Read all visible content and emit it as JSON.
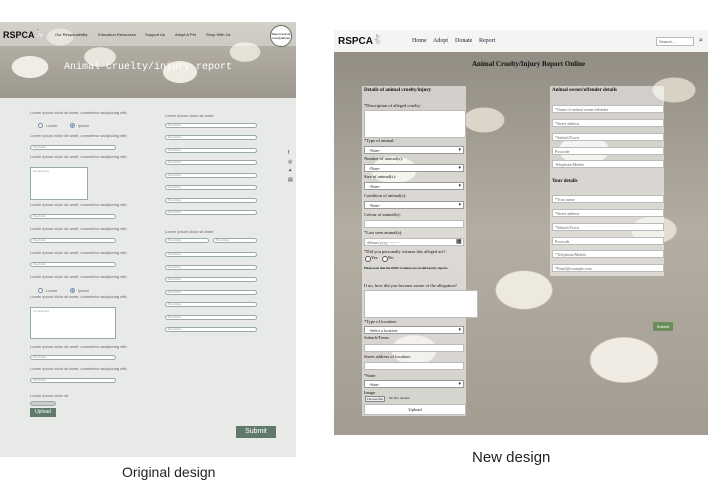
{
  "captions": {
    "original": "Original design",
    "new": "New design"
  },
  "original": {
    "logo": "RSPCA",
    "nav": [
      "Our Responsibility",
      "Education Resources",
      "Support Us",
      "Adopt A Pet",
      "Shop With Us"
    ],
    "badge": "Report animal cruelty/abuse",
    "title": "Animal cruelty/injury report",
    "lorem": "Lorem ipsum dolor sit amet, consetetur sadipscing elitr,",
    "lorem_short": "Lorem ipsum dolor sit amet",
    "radio_left": "Lorem",
    "radio_right": "Ipsum",
    "placeholder": "Placeholder",
    "textarea_ph": "Text area here",
    "upload_label": "Lorem ipsum dolor sit",
    "upload_button": "Upload",
    "submit": "Submit",
    "social_icons": [
      "facebook-icon",
      "instagram-icon",
      "twitter-icon",
      "cart-icon"
    ]
  },
  "new": {
    "logo": "RSPCA",
    "nav": [
      "Home",
      "Adopt",
      "Donate",
      "Report"
    ],
    "search_placeholder": "Search...",
    "title": "Animal Cruelty/Injury Report Online",
    "left": {
      "heading": "Details of animal cruelty/injury",
      "desc_label": "*Description of alleged cruelty:",
      "type_label": "*Type of animal:",
      "type_value": "-None-",
      "number_label": "Number of animal(s):",
      "number_value": "-None-",
      "size_label": "Size of animal(s):",
      "size_value": "-None-",
      "condition_label": "Condition of animal(s):",
      "condition_value": "-None-",
      "colour_label": "Colour of animal(s):",
      "last_seen_label": "*Last seen animal(s):",
      "date_placeholder": "dd/mm/yyyy, --:-- --",
      "witness_label": "*Did you personally witness this alleged act?",
      "witness_yes": "Yes",
      "witness_no": "No",
      "note": "Please note that the RSPCA cannot act on third party reports.",
      "aware_label": "If no, how did you become aware of the allegation?",
      "location_label": "*Type of location:",
      "location_value": "-Select a location-",
      "suburb_label": "Suburb/Town:",
      "street_label": "Street address of location:",
      "state_label": "*State:",
      "state_value": "-State-",
      "image_label": "Image",
      "choose_file": "Choose file",
      "no_file": "No file chosen",
      "upload": "Upload"
    },
    "right": {
      "owner_heading": "Animal owner/offender details",
      "owner_fields": [
        "*Name of animal owner/offender",
        "*Street address",
        "*Suburb/Town",
        "Postcode",
        "Telephone/Mobile"
      ],
      "your_heading": "Your details",
      "your_fields": [
        "*Your name",
        "*Street address",
        "*Suburb/Town",
        "Postcode",
        "*Telephone/Mobile",
        "*Email@example.com"
      ],
      "submit": "Submit"
    }
  }
}
